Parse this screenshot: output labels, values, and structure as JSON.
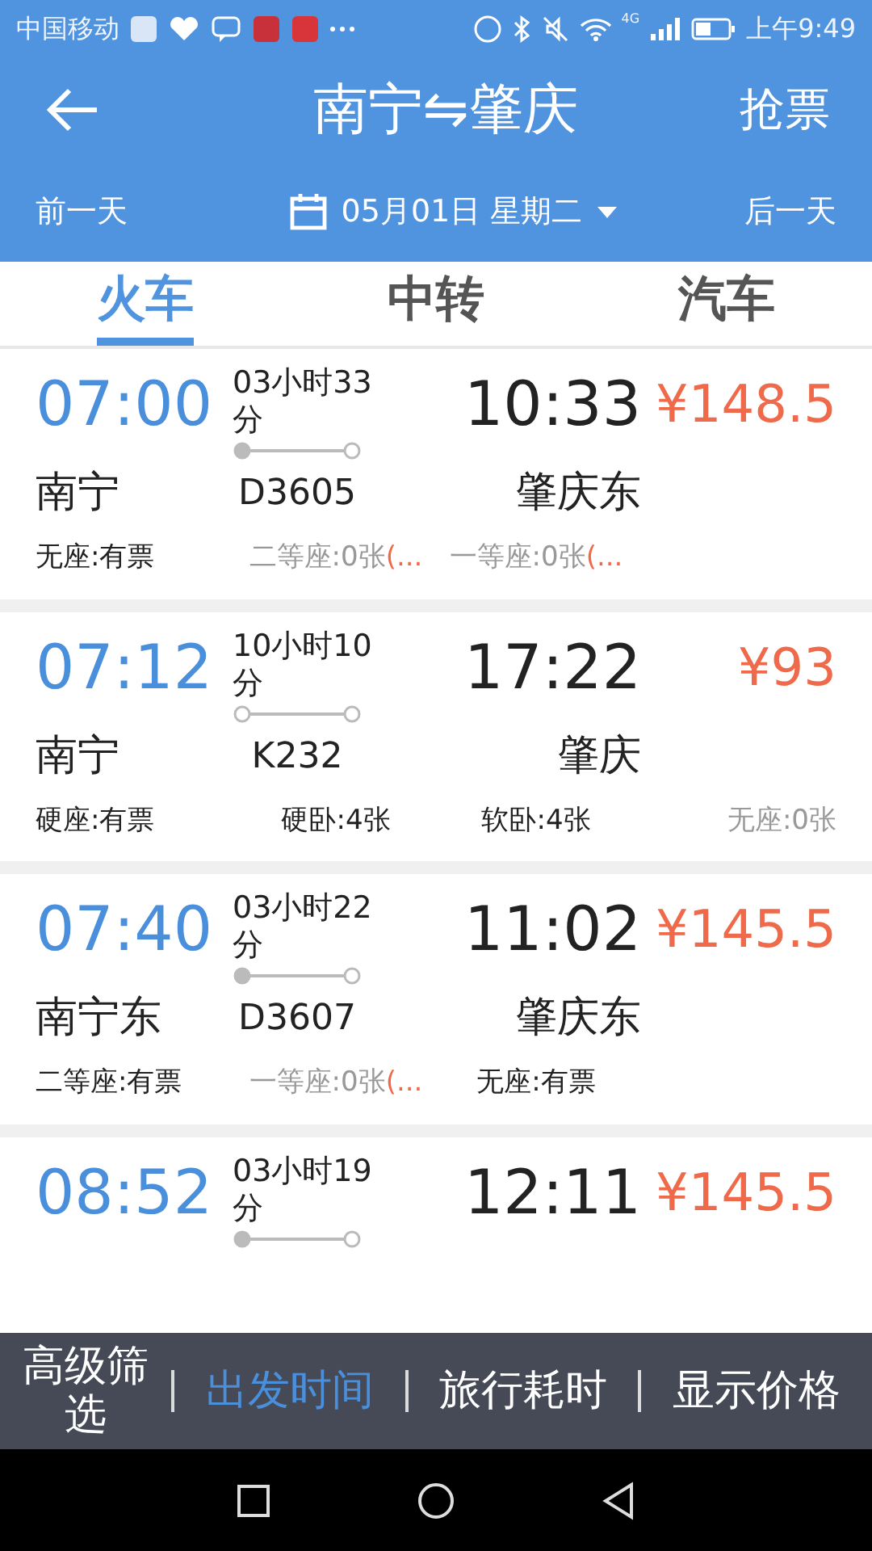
{
  "status_bar": {
    "carrier": "中国移动",
    "network": "4G",
    "time": "上午9:49"
  },
  "header": {
    "title": "南宁⇋肇庆",
    "action": "抢票",
    "prev_day": "前一天",
    "date": "05月01日 星期二",
    "next_day": "后一天"
  },
  "tabs": [
    {
      "label": "火车",
      "selected": true
    },
    {
      "label": "中转",
      "selected": false
    },
    {
      "label": "汽车",
      "selected": false
    }
  ],
  "trains": [
    {
      "depart": "07:00",
      "duration": "03小时33分",
      "arrive": "10:33",
      "price": "¥148.5",
      "from": "南宁",
      "code": "D3605",
      "to": "肇庆东",
      "origin_start": true,
      "seats": [
        {
          "text": "无座:有票",
          "available": true
        },
        {
          "text": "二等座:0张",
          "available": false,
          "note": "(..."
        },
        {
          "text": "一等座:0张",
          "available": false,
          "note": "(..."
        }
      ]
    },
    {
      "depart": "07:12",
      "duration": "10小时10分",
      "arrive": "17:22",
      "price": "¥93",
      "from": "南宁",
      "code": "K232",
      "to": "肇庆",
      "origin_start": false,
      "seats": [
        {
          "text": "硬座:有票",
          "available": true
        },
        {
          "text": "硬卧:4张",
          "available": true
        },
        {
          "text": "软卧:4张",
          "available": true
        },
        {
          "text": "无座:0张",
          "available": false
        }
      ]
    },
    {
      "depart": "07:40",
      "duration": "03小时22分",
      "arrive": "11:02",
      "price": "¥145.5",
      "from": "南宁东",
      "code": "D3607",
      "to": "肇庆东",
      "origin_start": true,
      "seats": [
        {
          "text": "二等座:有票",
          "available": true
        },
        {
          "text": "一等座:0张",
          "available": false,
          "note": "(..."
        },
        {
          "text": "无座:有票",
          "available": true
        }
      ]
    },
    {
      "depart": "08:52",
      "duration": "03小时19分",
      "arrive": "12:11",
      "price": "¥145.5",
      "origin_start": true
    }
  ],
  "sort_bar": [
    {
      "label": "高级筛选",
      "selected": false
    },
    {
      "label": "出发时间",
      "selected": true
    },
    {
      "label": "旅行耗时",
      "selected": false
    },
    {
      "label": "显示价格",
      "selected": false
    }
  ]
}
